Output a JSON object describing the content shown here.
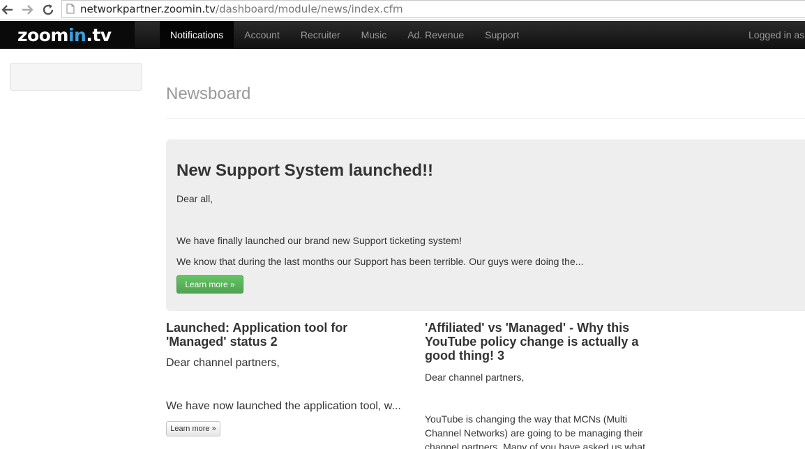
{
  "browser": {
    "url_host": "networkpartner.zoomin.tv",
    "url_path": "/dashboard/module/news/index.cfm"
  },
  "brand": {
    "prefix": "zoom",
    "in": "in",
    "suffix": ".tv"
  },
  "nav": {
    "items": [
      "Notifications",
      "Account",
      "Recruiter",
      "Music",
      "Ad. Revenue",
      "Support"
    ],
    "active": "Notifications",
    "logged_in": "Logged in as"
  },
  "main": {
    "title": "Newsboard",
    "hero": {
      "title": "New Support System launched!!",
      "greeting": "Dear all,",
      "line1": "We have finally launched our brand new Support ticketing system!",
      "line2": "We know that during the last months our Support has been terrible. Our guys were doing the...",
      "button": "Learn more »"
    },
    "articles": [
      {
        "title": "Launched: Application tool for 'Managed' status 2",
        "greeting": "Dear channel partners,",
        "excerpt": "We have now launched the application tool, w...",
        "button": "Learn more »"
      },
      {
        "title": "'Affiliated' vs 'Managed' - Why this YouTube policy change is actually a good thing! 3",
        "greeting": "Dear channel partners,",
        "excerpt": "YouTube is changing the way that MCNs (Multi Channel Networks) are going to be managing their channel partners. Many of you have asked us what"
      }
    ]
  },
  "colors": {
    "navbar": "#1b1b1b",
    "accent_green": "#5bb75b",
    "brand_blue": "#3aa0e0"
  }
}
